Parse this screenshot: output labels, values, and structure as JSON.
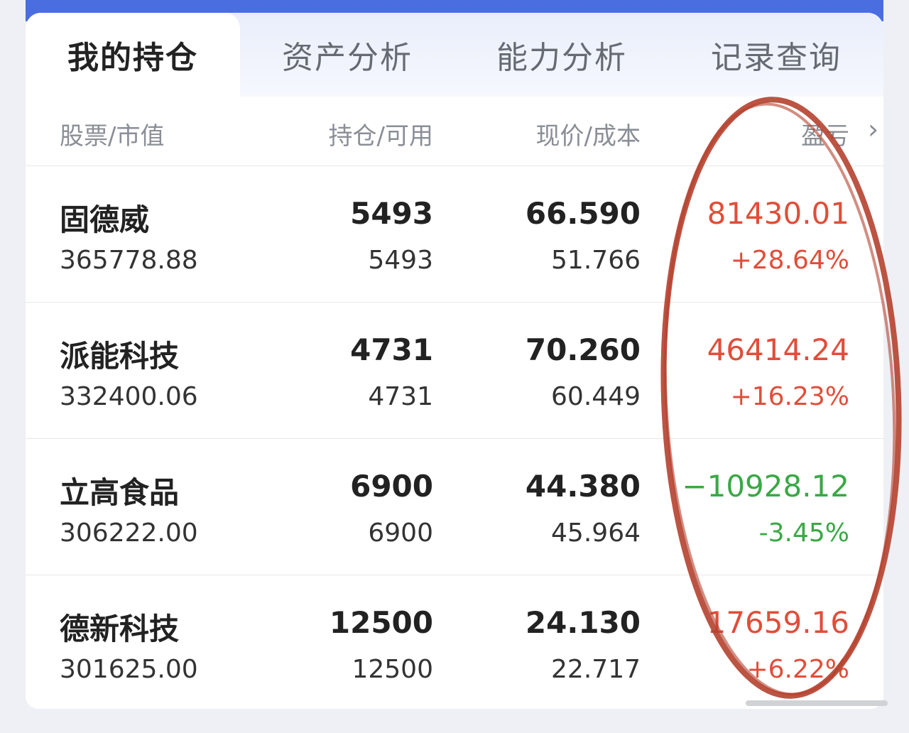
{
  "tabs": [
    {
      "label": "我的持仓",
      "active": true
    },
    {
      "label": "资产分析",
      "active": false
    },
    {
      "label": "能力分析",
      "active": false
    },
    {
      "label": "记录查询",
      "active": false
    }
  ],
  "header": {
    "col1": "股票/市值",
    "col2": "持仓/可用",
    "col3": "现价/成本",
    "col4": "盈亏",
    "chevron": "chevron-right-icon"
  },
  "rows": [
    {
      "name": "固德威",
      "market_value": "365778.88",
      "position": "5493",
      "available": "5493",
      "price": "66.590",
      "cost": "51.766",
      "pl": "81430.01",
      "pl_pct": "+28.64%",
      "trend": "up"
    },
    {
      "name": "派能科技",
      "market_value": "332400.06",
      "position": "4731",
      "available": "4731",
      "price": "70.260",
      "cost": "60.449",
      "pl": "46414.24",
      "pl_pct": "+16.23%",
      "trend": "up"
    },
    {
      "name": "立高食品",
      "market_value": "306222.00",
      "position": "6900",
      "available": "6900",
      "price": "44.380",
      "cost": "45.964",
      "pl": "−10928.12",
      "pl_pct": "-3.45%",
      "trend": "down"
    },
    {
      "name": "德新科技",
      "market_value": "301625.00",
      "position": "12500",
      "available": "12500",
      "price": "24.130",
      "cost": "22.717",
      "pl": "17659.16",
      "pl_pct": "+6.22%",
      "trend": "up"
    }
  ],
  "colors": {
    "accent": "#4a6ee0",
    "profit": "#e04e39",
    "loss": "#3aa845",
    "annotation": "#b5412f"
  }
}
